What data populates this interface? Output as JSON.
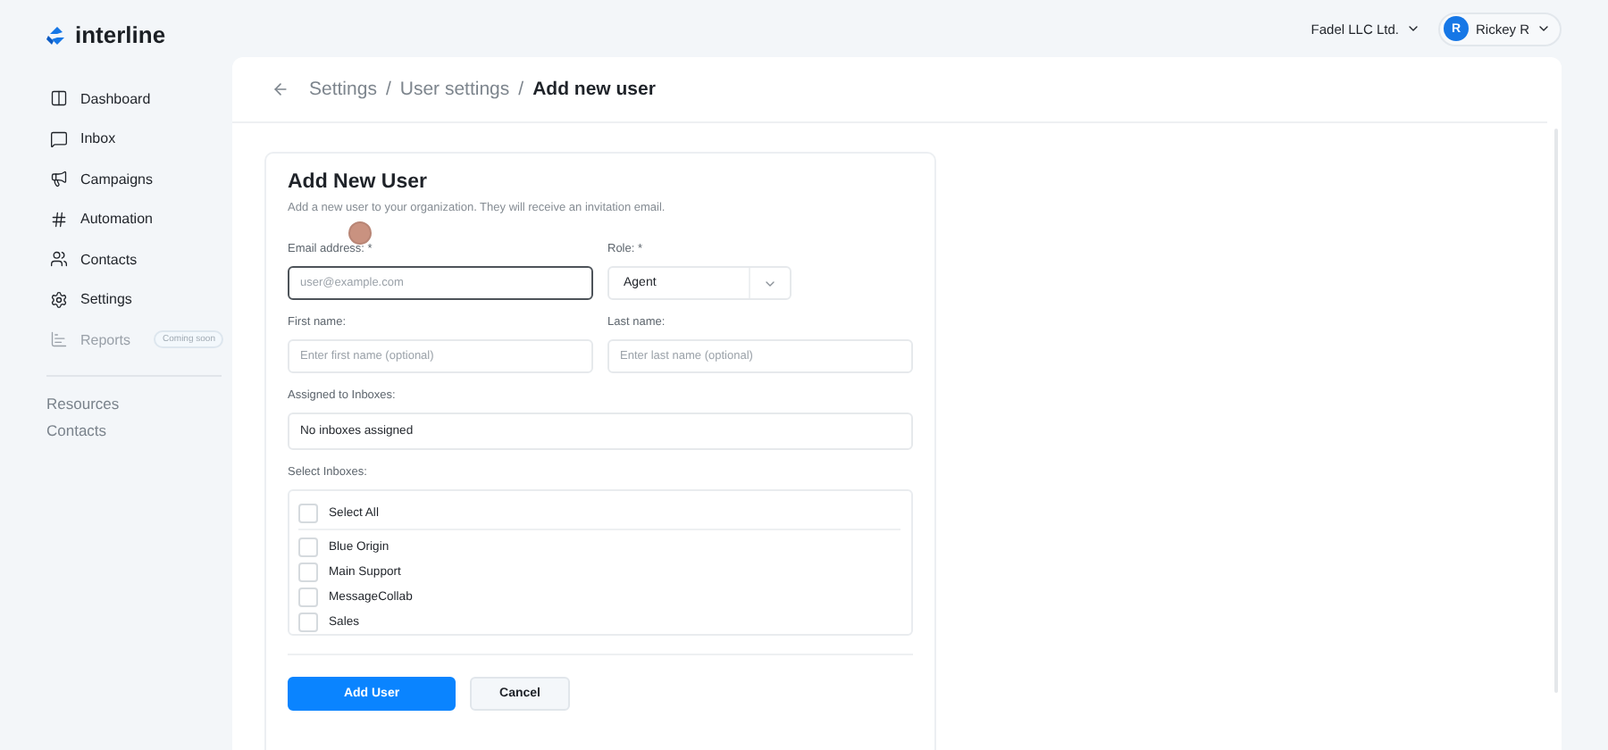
{
  "brand": "interline",
  "sidebar": {
    "items": [
      {
        "label": "Dashboard",
        "disabled": false
      },
      {
        "label": "Inbox",
        "disabled": false
      },
      {
        "label": "Campaigns",
        "disabled": false
      },
      {
        "label": "Automation",
        "disabled": false
      },
      {
        "label": "Contacts",
        "disabled": false
      },
      {
        "label": "Settings",
        "disabled": false
      },
      {
        "label": "Reports",
        "disabled": true,
        "badge": "Coming soon"
      }
    ],
    "links": [
      "Resources",
      "Contacts"
    ]
  },
  "topbar": {
    "organization": "Fadel LLC Ltd.",
    "user": {
      "initial": "R",
      "name": "Rickey R"
    }
  },
  "breadcrumb": [
    {
      "label": "Settings",
      "separator": "/",
      "current": false
    },
    {
      "label": "User settings",
      "separator": "/",
      "current": false
    },
    {
      "label": "Add new user",
      "current": true
    }
  ],
  "form": {
    "title": "Add New User",
    "description": "Add a new user to your organization. They will receive an invitation email.",
    "email": {
      "label": "Email address: *",
      "placeholder": "user@example.com",
      "focused": true
    },
    "role": {
      "label": "Role: *",
      "value": "Agent"
    },
    "first_name": {
      "label": "First name:",
      "placeholder": "Enter first name (optional)"
    },
    "last_name": {
      "label": "Last name:",
      "placeholder": "Enter last name (optional)"
    },
    "assigned": {
      "label": "Assigned to Inboxes:",
      "value": "No inboxes assigned"
    },
    "inboxes": {
      "label": "Select Inboxes:",
      "select_all": {
        "label": "Select All",
        "checked": false
      },
      "items": [
        {
          "label": "Blue Origin",
          "checked": false
        },
        {
          "label": "Main Support",
          "checked": false
        },
        {
          "label": "MessageCollab",
          "checked": false
        },
        {
          "label": "Sales",
          "checked": false
        }
      ]
    },
    "buttons": [
      {
        "label": "Add User",
        "kind": "primary"
      },
      {
        "label": "Cancel",
        "kind": "secondary"
      }
    ]
  }
}
